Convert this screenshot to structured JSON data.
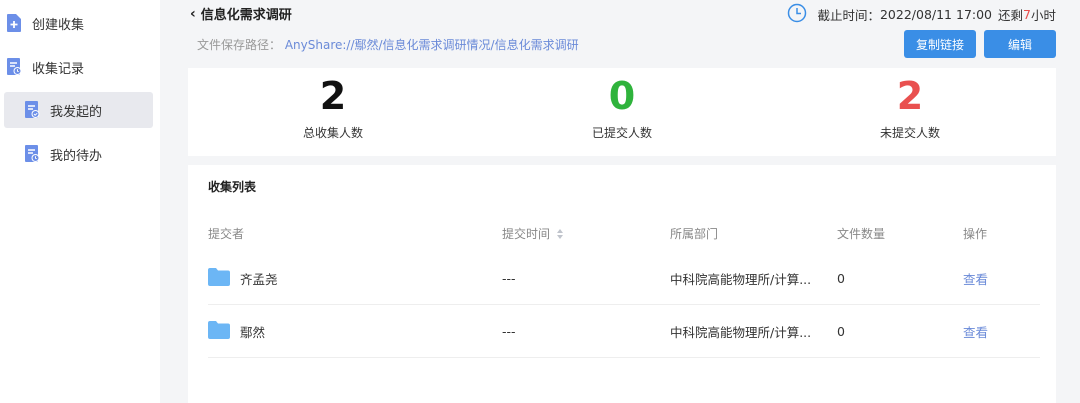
{
  "sidebar": {
    "items": [
      {
        "label": "创建收集",
        "icon": "add-document-icon"
      },
      {
        "label": "收集记录",
        "icon": "record-document-icon"
      },
      {
        "label": "我发起的",
        "icon": "initiated-document-icon"
      },
      {
        "label": "我的待办",
        "icon": "todo-document-icon"
      }
    ]
  },
  "header": {
    "back_icon": "chevron-left-icon",
    "title": "信息化需求调研",
    "path_label": "文件保存路径：",
    "path_value": "AnyShare://鄢然/信息化需求调研情况/信息化需求调研",
    "deadline_icon": "clock-icon",
    "deadline_label": "截止时间：",
    "deadline_value": "2022/08/11 17:00",
    "remain_prefix": "还剩",
    "remain_num": "7",
    "remain_suffix": "小时",
    "copy_link_label": "复制链接",
    "edit_label": "编辑"
  },
  "stats": [
    {
      "value": "2",
      "label": "总收集人数",
      "color": "#111111"
    },
    {
      "value": "0",
      "label": "已提交人数",
      "color": "#2fb33c"
    },
    {
      "value": "2",
      "label": "未提交人数",
      "color": "#e9504f"
    }
  ],
  "list": {
    "title": "收集列表",
    "columns": [
      "提交者",
      "提交时间",
      "所属部门",
      "文件数量",
      "操作"
    ],
    "sort_icon": "sort-icon",
    "rows": [
      {
        "submitter": "齐孟尧",
        "time": "---",
        "dept": "中科院高能物理所/计算...",
        "files": "0",
        "action": "查看",
        "icon": "folder-icon"
      },
      {
        "submitter": "鄢然",
        "time": "---",
        "dept": "中科院高能物理所/计算...",
        "files": "0",
        "action": "查看",
        "icon": "folder-icon"
      }
    ]
  },
  "colors": {
    "accent": "#3a8ee6",
    "link": "#6a8ad8",
    "danger": "#e9504f",
    "success": "#2fb33c"
  }
}
